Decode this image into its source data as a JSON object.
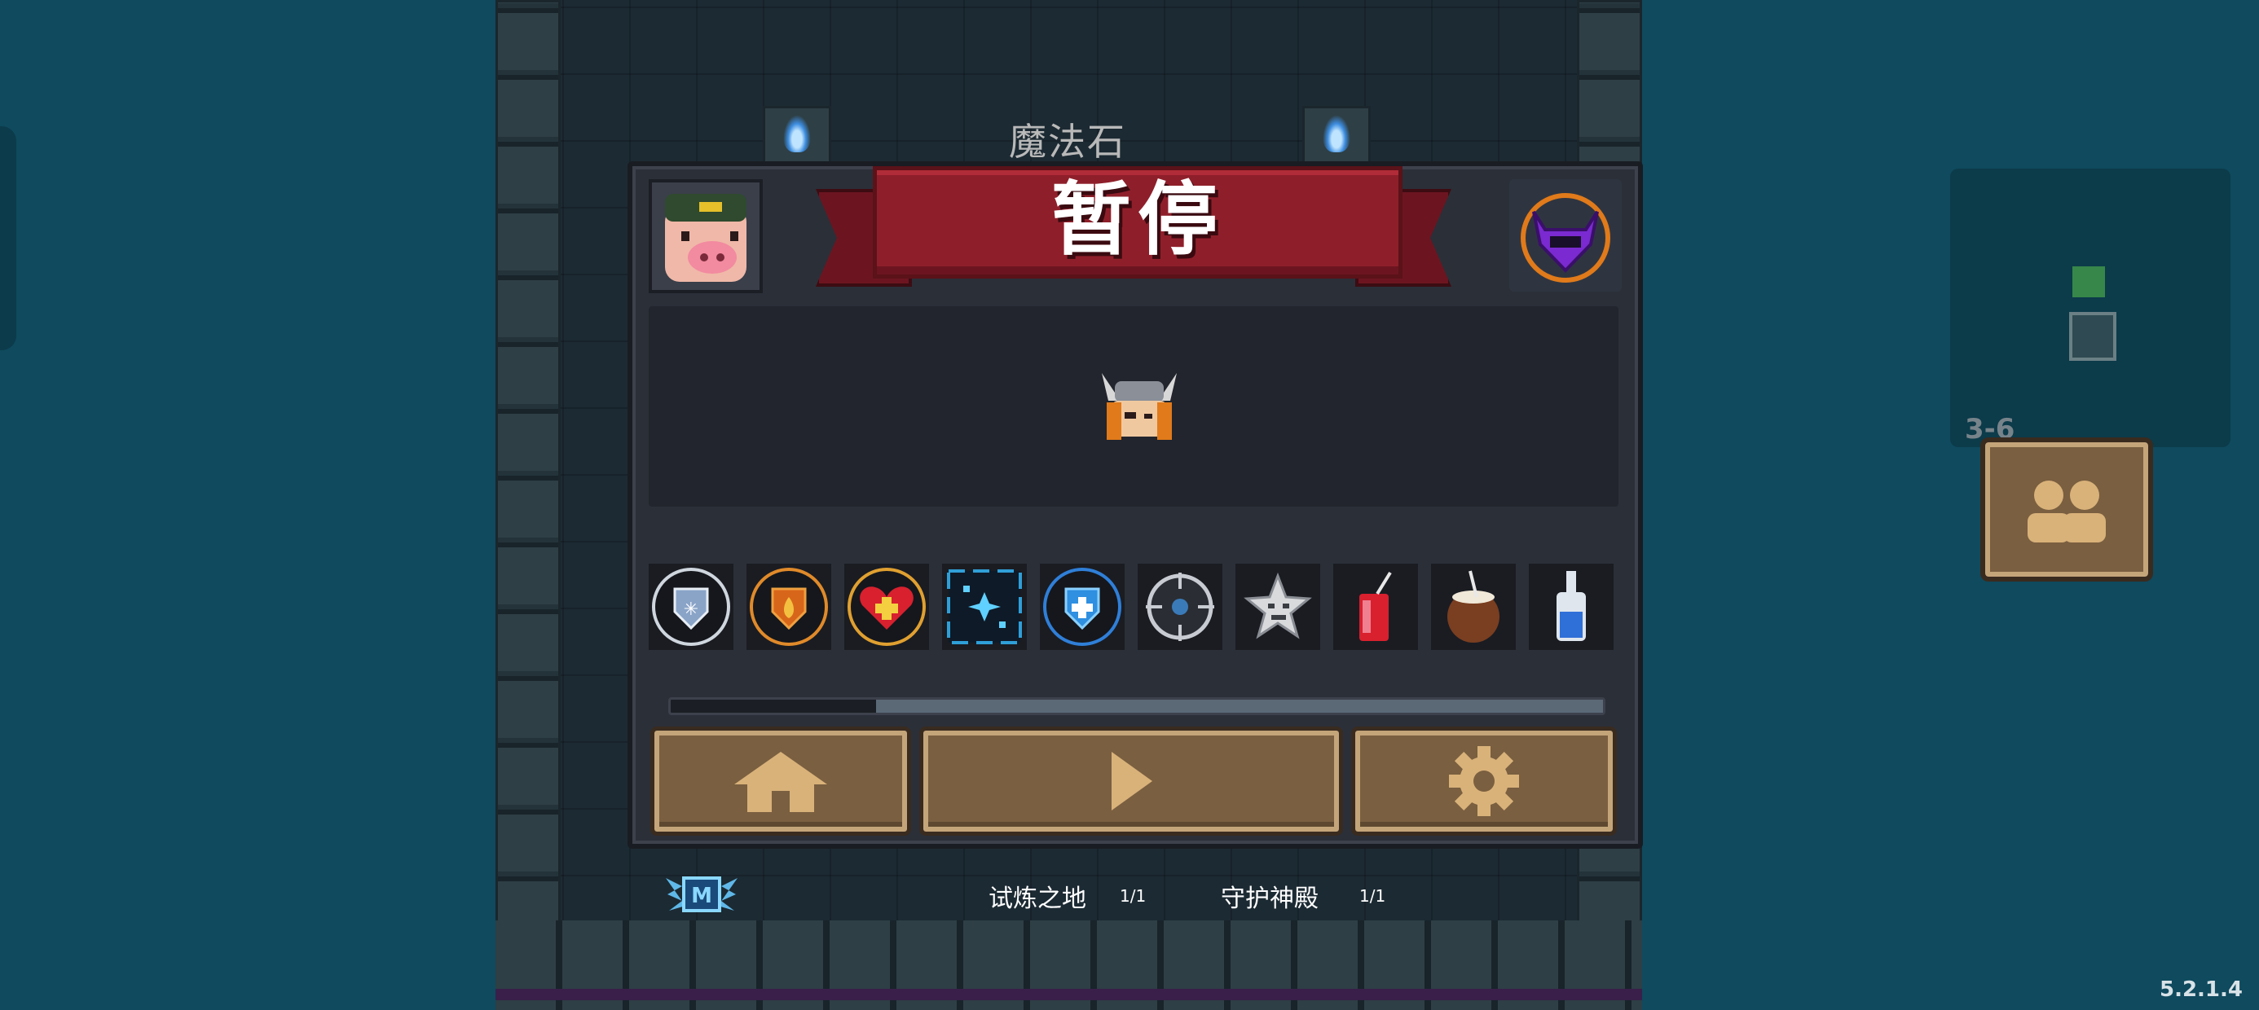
{
  "background": {
    "map_object_label": "魔法石"
  },
  "pause_menu": {
    "title": "暂停",
    "character_portrait_icon": "pig-hero-icon",
    "difficulty_badge_icon": "purple-horned-helmet-icon",
    "hero_preview_icon": "viking-pet-icon",
    "buffs": [
      {
        "icon": "ice-shield-buff-icon",
        "ring": "#cfd6de"
      },
      {
        "icon": "fire-shield-buff-icon",
        "ring": "#e08a2a"
      },
      {
        "icon": "heart-heal-buff-icon",
        "ring": "#e0a030"
      },
      {
        "icon": "sparkle-buff-icon",
        "ring": "#2f9fd8"
      },
      {
        "icon": "blue-shield-buff-icon",
        "ring": "#2f7fd8"
      },
      {
        "icon": "compass-buff-icon",
        "ring": "#9aa3ad"
      },
      {
        "icon": "star-face-buff-icon",
        "ring": "#1a1c22"
      },
      {
        "icon": "red-drink-buff-icon",
        "ring": "#1a1c22"
      },
      {
        "icon": "coconut-drink-buff-icon",
        "ring": "#1a1c22"
      },
      {
        "icon": "potion-bottle-buff-icon",
        "ring": "#1a1c22"
      }
    ],
    "buff_scroll_position": 0.22,
    "buttons": {
      "home_icon": "home-icon",
      "resume_icon": "play-icon",
      "settings_icon": "gear-icon"
    }
  },
  "footer": {
    "badge_icon": "winged-m-badge-icon",
    "challenges": [
      {
        "name": "试炼之地",
        "progress": "1/1"
      },
      {
        "name": "守护神殿",
        "progress": "1/1"
      }
    ]
  },
  "minimap": {
    "level": "3-6",
    "multiplayer_icon": "players-icon"
  },
  "version": "5.2.1.4",
  "colors": {
    "banner_red": "#8e1f2a",
    "button_brown": "#7a5f40",
    "panel": "#2b2f38",
    "background_teal": "#0f4a5e"
  }
}
